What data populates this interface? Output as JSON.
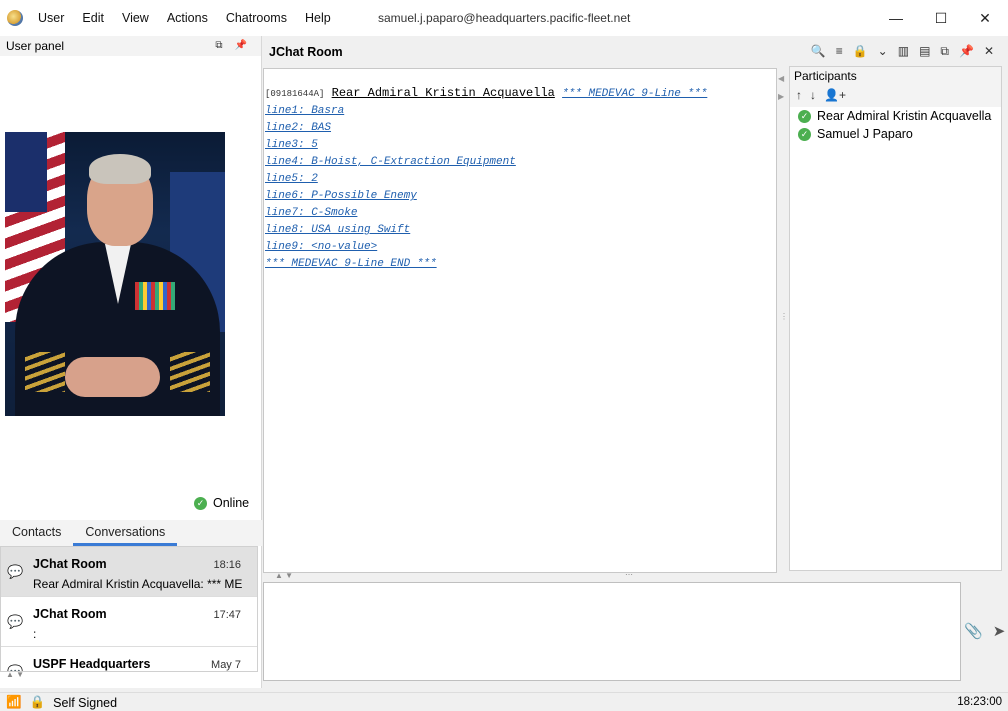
{
  "window": {
    "user_title": "samuel.j.paparo@headquarters.pacific-fleet.net",
    "minimize": "—",
    "maximize": "☐",
    "close": "✕"
  },
  "menu": [
    "User",
    "Edit",
    "View",
    "Actions",
    "Chatrooms",
    "Help"
  ],
  "user_panel": {
    "title": "User panel",
    "status": "Online"
  },
  "tabs": [
    "Contacts",
    "Conversations"
  ],
  "conversations": [
    {
      "name": "JChat Room",
      "time": "18:16",
      "message": "Rear Admiral Kristin Acquavella: *** MEDI"
    },
    {
      "name": "JChat Room",
      "time": "17:47",
      "message": ":"
    },
    {
      "name": "USPF Headquarters",
      "time": "May 7",
      "message": ""
    }
  ],
  "chat": {
    "title": "JChat Room",
    "stamp": "[09181644A]",
    "sender": "Rear Admiral Kristin Acquavella",
    "header_text": "*** MEDEVAC 9-Line ***",
    "lines": [
      "line1: Basra",
      "line2: BAS",
      "line3: 5",
      "line4: B-Hoist, C-Extraction Equipment",
      "line5: 2",
      "line6: P-Possible Enemy",
      "line7: C-Smoke",
      "line8: USA using Swift",
      "line9: <no-value>",
      "*** MEDEVAC 9-Line END ***"
    ]
  },
  "participants": {
    "title": "Participants",
    "list": [
      "Rear Admiral Kristin Acquavella",
      "Samuel J Paparo"
    ]
  },
  "statusbar": {
    "security": "Self Signed",
    "clock": "18:23:00"
  },
  "colors": {
    "accent": "#3a7bd5",
    "link": "#1f5fae",
    "online": "#4caf50"
  }
}
